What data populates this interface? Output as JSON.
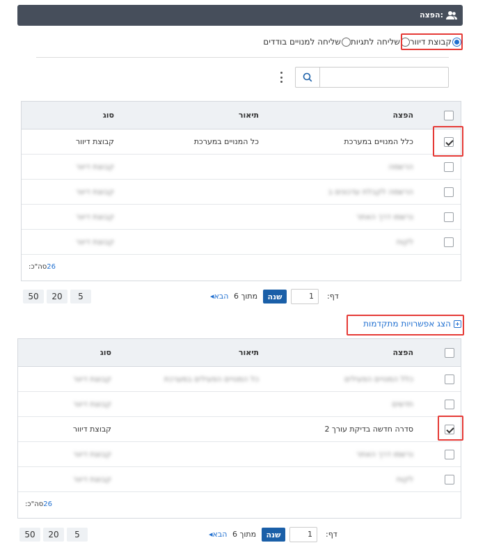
{
  "header": {
    "title": "הפצה:",
    "icon": "users-icon"
  },
  "distribution_options": [
    {
      "label": "קבוצת דיוור",
      "selected": true
    },
    {
      "label": "שליחה לתגיות",
      "selected": false
    },
    {
      "label": "שליחה למנויים בודדים",
      "selected": false
    }
  ],
  "search": {
    "value": "",
    "placeholder": ""
  },
  "grid1": {
    "columns": {
      "distribution": "הפצה",
      "description": "תיאור",
      "type": "סוג"
    },
    "rows": [
      {
        "distribution": "כלל המנויים במערכת",
        "description": "כל המנויים במערכת",
        "type": "קבוצת דיוור",
        "checked": true,
        "blurred": false
      },
      {
        "distribution": "הרשמה",
        "description": "",
        "type": "קבוצת דיוור",
        "checked": false,
        "blurred": true
      },
      {
        "distribution": "הרשמה לקבלת עדכונים ב",
        "description": "",
        "type": "קבוצת דיוור",
        "checked": false,
        "blurred": true
      },
      {
        "distribution": "נרשמו דרך האתר",
        "description": "",
        "type": "קבוצת דיוור",
        "checked": false,
        "blurred": true
      },
      {
        "distribution": "לקוח",
        "description": "",
        "type": "קבוצת דיוור",
        "checked": false,
        "blurred": true
      }
    ],
    "total_label": "סה\"כ:",
    "total_value": "26"
  },
  "pager1": {
    "page_label": "דף:",
    "page_value": "1",
    "go_label": "שנה",
    "of_label": "מתוך 6",
    "next_label": "הבא",
    "sizes": [
      "50",
      "20",
      "5"
    ]
  },
  "advanced": {
    "label": "הצג אפשרויות מתקדמות"
  },
  "grid2": {
    "columns": {
      "distribution": "הפצה",
      "description": "תיאור",
      "type": "סוג"
    },
    "rows": [
      {
        "distribution": "כלל המנויים הפעילים",
        "description": "כל המנויים הפעילים במערכת",
        "type": "קבוצת דיוור",
        "checked": false,
        "blurred": true
      },
      {
        "distribution": "חדשים",
        "description": "",
        "type": "קבוצת דיוור",
        "checked": false,
        "blurred": true
      },
      {
        "distribution": "סדרה חדשה בדיקת עורך 2",
        "description": "",
        "type": "קבוצת דיוור",
        "checked": true,
        "blurred": false
      },
      {
        "distribution": "נרשמו דרך האתר",
        "description": "",
        "type": "קבוצת דיוור",
        "checked": false,
        "blurred": true
      },
      {
        "distribution": "לקוח",
        "description": "",
        "type": "קבוצת דיוור",
        "checked": false,
        "blurred": true
      }
    ],
    "total_label": "סה\"כ:",
    "total_value": "26"
  },
  "pager2": {
    "page_label": "דף:",
    "page_value": "1",
    "go_label": "שנה",
    "of_label": "מתוך 6",
    "next_label": "הבא",
    "sizes": [
      "50",
      "20",
      "5"
    ]
  },
  "colors": {
    "header_bg": "#464e5b",
    "accent": "#1f6fd0",
    "go_button": "#1a5fa8",
    "highlight": "#e53935"
  }
}
